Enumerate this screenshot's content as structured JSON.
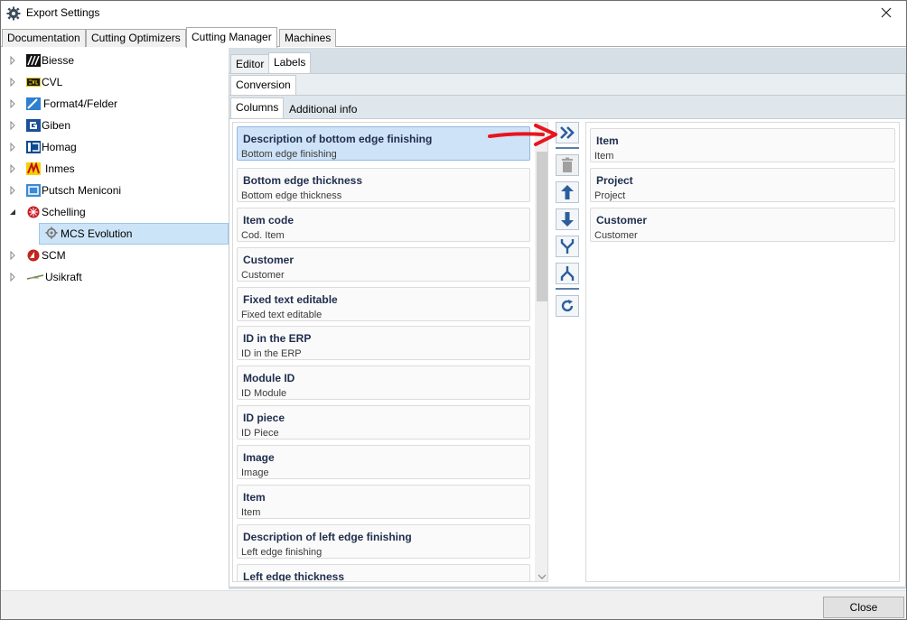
{
  "window": {
    "title": "Export Settings"
  },
  "top_tabs": [
    "Documentation",
    "Cutting Optimizers",
    "Cutting Manager",
    "Machines"
  ],
  "active_top_tab": "Cutting Manager",
  "tree": [
    {
      "label": "Biesse",
      "logo": "biesse-logo"
    },
    {
      "label": "CVL",
      "logo": "cvl-logo"
    },
    {
      "label": "Format4/Felder",
      "logo": "format4-logo"
    },
    {
      "label": "Giben",
      "logo": "giben-logo"
    },
    {
      "label": "Homag",
      "logo": "homag-logo"
    },
    {
      "label": "Inmes",
      "logo": "inmes-logo"
    },
    {
      "label": "Putsch Meniconi",
      "logo": "putsch-logo"
    },
    {
      "label": "Schelling",
      "logo": "schelling-logo",
      "expanded": true
    },
    {
      "label": "MCS Evolution",
      "logo": "gear-icon",
      "child": true,
      "selected": true
    },
    {
      "label": "SCM",
      "logo": "scm-logo"
    },
    {
      "label": "Usikraft",
      "logo": "usikraft-logo"
    }
  ],
  "editor_tabs": [
    "Editor",
    "Labels"
  ],
  "conversion_tab": "Conversion",
  "sub_tabs": [
    "Columns",
    "Additional info"
  ],
  "available_columns": [
    {
      "title": "Description of bottom edge finishing",
      "sub": "Bottom edge finishing",
      "selected": true
    },
    {
      "title": "Bottom edge thickness",
      "sub": "Bottom edge thickness"
    },
    {
      "title": "Item code",
      "sub": "Cod. Item"
    },
    {
      "title": "Customer",
      "sub": "Customer"
    },
    {
      "title": "Fixed text editable",
      "sub": "Fixed text editable"
    },
    {
      "title": "ID in the ERP",
      "sub": "ID in the ERP"
    },
    {
      "title": "Module ID",
      "sub": "ID Module"
    },
    {
      "title": "ID piece",
      "sub": "ID Piece"
    },
    {
      "title": "Image",
      "sub": "Image"
    },
    {
      "title": "Item",
      "sub": "Item"
    },
    {
      "title": "Description of left edge finishing",
      "sub": "Left edge finishing"
    },
    {
      "title": "Left edge thickness",
      "sub": ""
    }
  ],
  "selected_columns": [
    {
      "title": "Item",
      "sub": "Item"
    },
    {
      "title": "Project",
      "sub": "Project"
    },
    {
      "title": "Customer",
      "sub": "Customer"
    }
  ],
  "tool_buttons": [
    "add-columns",
    "delete",
    "move-up",
    "move-down",
    "merge",
    "split",
    "refresh"
  ],
  "footer": {
    "close_label": "Close"
  },
  "colors": {
    "accent": "#2c5e9c",
    "selection": "#cfe3f8",
    "panel": "#d5dfe5",
    "arrow": "#e8141e"
  }
}
